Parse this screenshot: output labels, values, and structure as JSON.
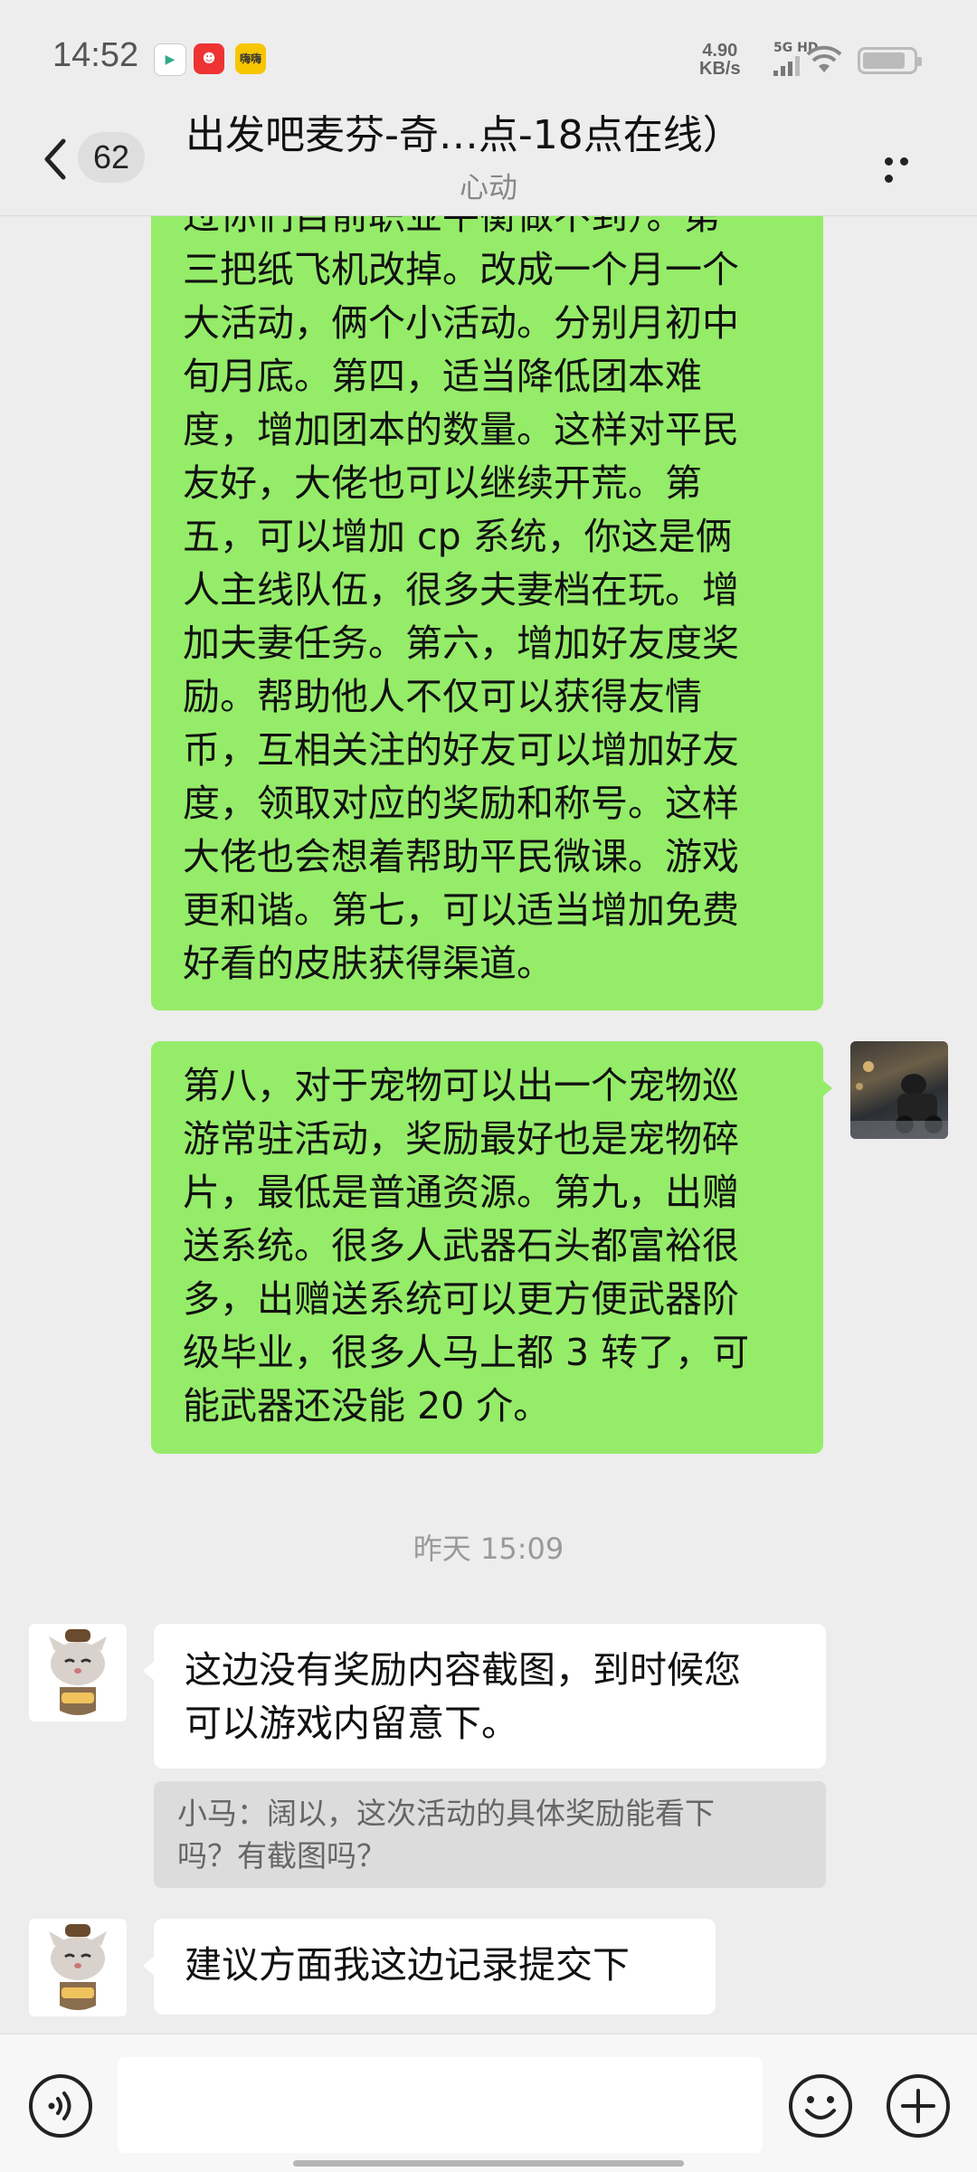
{
  "status_bar": {
    "time": "14:52",
    "net_speed_value": "4.90",
    "net_speed_unit": "KB/s",
    "signal_tag": "5G HD",
    "battery_level": 0.85,
    "notification_icons": [
      "video-app-icon",
      "red-app-icon",
      "yellow-app-icon"
    ],
    "yellow_app_text": "嗨嗨"
  },
  "header": {
    "unread_count": "62",
    "title": "出发吧麦芬-奇…点-18点在线）",
    "subtitle": "心动"
  },
  "messages": {
    "msg1_partial_top": "过你们目前职业平衡做不到）。第",
    "msg1_lines": [
      "三把纸飞机改掉。改成一个月一个",
      "大活动，俩个小活动。分别月初中",
      "旬月底。第四，适当降低团本难",
      "度，增加团本的数量。这样对平民",
      "友好，大佬也可以继续开荒。第",
      "五，可以增加 cp 系统，你这是俩",
      "人主线队伍，很多夫妻档在玩。增",
      "加夫妻任务。第六，增加好友度奖",
      "励。帮助他人不仅可以获得友情",
      "币，互相关注的好友可以增加好友",
      "度，领取对应的奖励和称号。这样",
      "大佬也会想着帮助平民微课。游戏",
      "更和谐。第七，可以适当增加免费",
      "好看的皮肤获得渠道。"
    ],
    "msg2_lines": [
      "第八，对于宠物可以出一个宠物巡",
      "游常驻活动，奖励最好也是宠物碎",
      "片，最低是普通资源。第九，出赠",
      "送系统。很多人武器石头都富裕很",
      "多，出赠送系统可以更方便武器阶",
      "级毕业，很多人马上都 3 转了，可",
      "能武器还没能 20 介。"
    ],
    "timestamp": "昨天 15:09",
    "msg3_lines": [
      "这边没有奖励内容截图，到时候您",
      "可以游戏内留意下。"
    ],
    "quote_lines": [
      "小马：阔以，这次活动的具体奖励能看下",
      "吗？有截图吗？"
    ],
    "msg4": "建议方面我这边记录提交下"
  },
  "input_bar": {
    "value": "",
    "placeholder": ""
  },
  "colors": {
    "background": "#ededed",
    "own_bubble": "#95ec69",
    "other_bubble": "#ffffff",
    "quote_bg": "#dcdcdc"
  }
}
